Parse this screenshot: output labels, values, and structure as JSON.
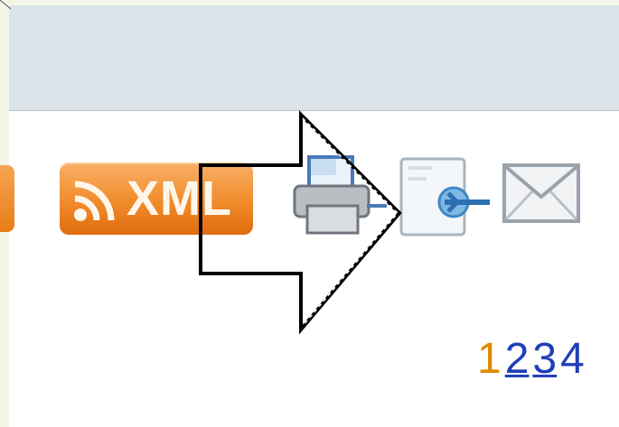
{
  "toolbar": {
    "feed_badge_text": "XML",
    "icons": [
      "rss-icon",
      "print-icon",
      "share-icon",
      "email-icon"
    ]
  },
  "pagination": {
    "current": "1",
    "pages": [
      "2",
      "3"
    ],
    "partial": "4"
  },
  "colors": {
    "header_bg": "#dbe3e8",
    "xml_badge": "#f08b2b",
    "link": "#1f3fb8",
    "current_page": "#e08a00"
  }
}
